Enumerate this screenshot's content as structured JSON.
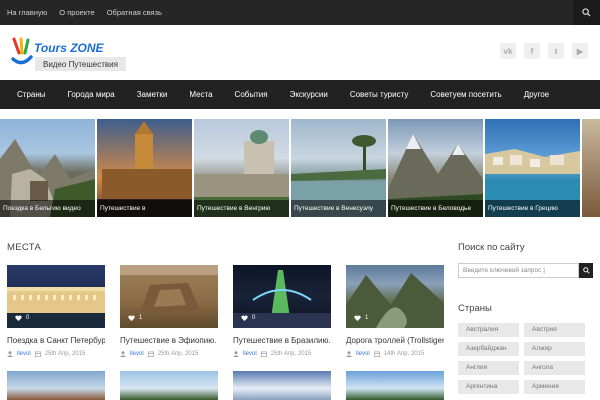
{
  "topbar": {
    "links": [
      "На главную",
      "О проекте",
      "Обратная связь"
    ]
  },
  "header": {
    "logo_name": "Tours ZONE",
    "logo_tagline": "Видео Путешествия",
    "social": [
      {
        "icon": "vk-icon",
        "glyph": "vk"
      },
      {
        "icon": "facebook-icon",
        "glyph": "f"
      },
      {
        "icon": "twitter-icon",
        "glyph": "t"
      },
      {
        "icon": "youtube-icon",
        "glyph": "▶"
      }
    ]
  },
  "nav": {
    "items": [
      "Страны",
      "Города мира",
      "Заметки",
      "Места",
      "События",
      "Экскурсии",
      "Советы туристу",
      "Советуем посетить",
      "Другое"
    ]
  },
  "slider": [
    {
      "caption": "Поездка в Бельгию видео"
    },
    {
      "caption": "Путешествие в"
    },
    {
      "caption": "Путешествие в Венгрию"
    },
    {
      "caption": "Путешествие в Венесуэлу"
    },
    {
      "caption": "Путешествие в Беловодье"
    },
    {
      "caption": "Путешествие в Грецию"
    }
  ],
  "section": {
    "title": "МЕСТА"
  },
  "posts": [
    {
      "title": "Поездка в Санкт Петербург",
      "likes": "0",
      "author": "llevol",
      "date": "25th Апр, 2015"
    },
    {
      "title": "Путешествие в Эфиопию.",
      "likes": "1",
      "author": "llevol",
      "date": "25th Апр, 2015"
    },
    {
      "title": "Путешествие в Бразилию.",
      "likes": "0",
      "author": "llevol",
      "date": "25th Апр, 2015"
    },
    {
      "title": "Дорога троллей (Trollstigen)",
      "likes": "1",
      "author": "llevol",
      "date": "14th Апр, 2015"
    }
  ],
  "sidebar": {
    "search_title": "Поиск по сайту",
    "search_placeholder": "Введите ключевой запрос |",
    "countries_title": "Страны",
    "countries": [
      "Австралия",
      "Австрия",
      "Азербайджан",
      "Алжир",
      "Англия",
      "Ангола",
      "Аргентина",
      "Армения"
    ]
  },
  "colors": {
    "topbar": "#262626",
    "nav": "#222222",
    "accent": "#1b6fd0"
  }
}
